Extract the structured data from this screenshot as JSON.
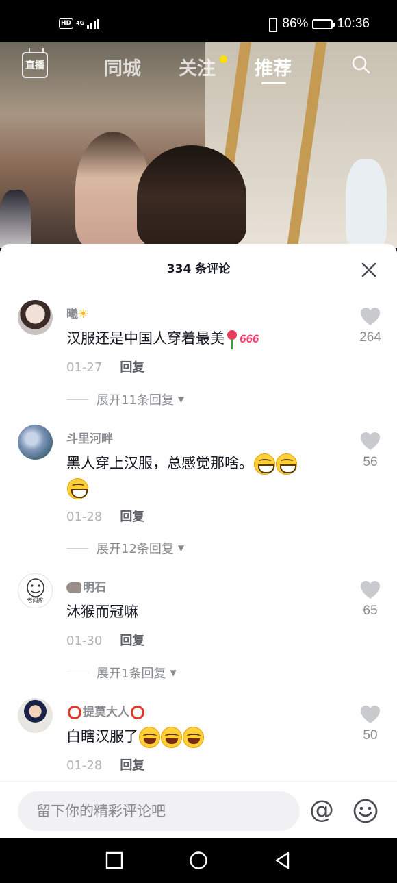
{
  "status_bar": {
    "hd": "HD",
    "network": "4G",
    "battery_percent": "86%",
    "battery_level": 0.86,
    "time": "10:36"
  },
  "top_nav": {
    "live_label": "直播",
    "tabs": [
      {
        "label": "同城",
        "active": false
      },
      {
        "label": "关注",
        "active": false,
        "has_dot": true
      },
      {
        "label": "推荐",
        "active": true
      }
    ],
    "dot_color": "#fbe000"
  },
  "comments_panel": {
    "title": "334 条评论",
    "comments": [
      {
        "username": "曦",
        "text": "汉服还是中国人穿着最美",
        "sticker_text": "666",
        "date": "01-27",
        "reply_label": "回复",
        "likes": "264",
        "expand_label": "展开11条回复"
      },
      {
        "username": "斗里河畔",
        "text": "黑人穿上汉服，总感觉那啥。",
        "date": "01-28",
        "reply_label": "回复",
        "likes": "56",
        "expand_label": "展开12条回复"
      },
      {
        "username": "明石",
        "avatar_text": "老阎疼",
        "text": "沐猴而冠嘛",
        "date": "01-30",
        "reply_label": "回复",
        "likes": "65",
        "expand_label": "展开1条回复"
      },
      {
        "username": "提莫大人",
        "text": "白瞎汉服了",
        "date": "01-28",
        "reply_label": "回复",
        "likes": "50"
      }
    ]
  },
  "input_bar": {
    "placeholder": "留下你的精彩评论吧"
  },
  "icons": [
    "live-icon",
    "search-icon",
    "close-icon",
    "heart-icon",
    "at-icon",
    "emoji-icon",
    "back-icon",
    "home-icon",
    "recents-icon"
  ]
}
